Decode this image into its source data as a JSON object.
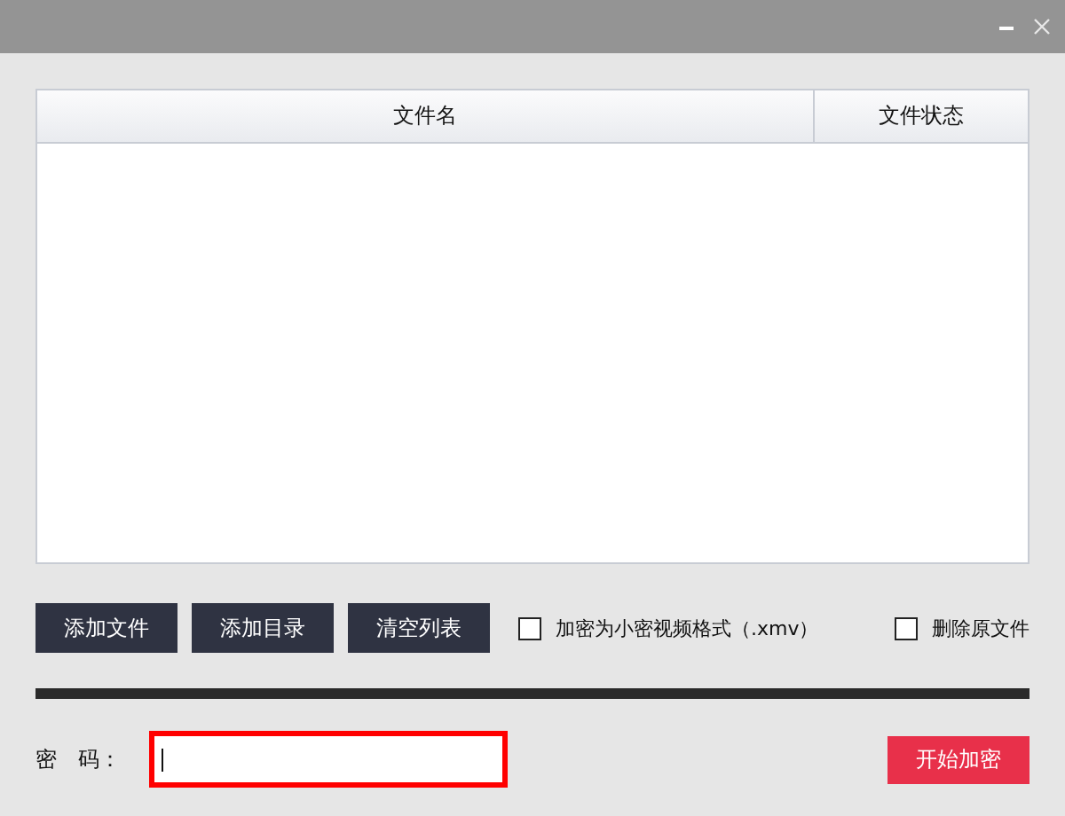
{
  "table": {
    "columns": [
      "文件名",
      "文件状态"
    ]
  },
  "buttons": [
    "添加文件",
    "添加目录",
    "清空列表"
  ],
  "options": [
    {
      "label": "加密为小密视频格式（.xmv）",
      "checked": false
    },
    {
      "label": "删除原文件",
      "checked": false
    }
  ],
  "password": {
    "label": "密　码：",
    "highlighted": true
  },
  "start_button": "开始加密"
}
